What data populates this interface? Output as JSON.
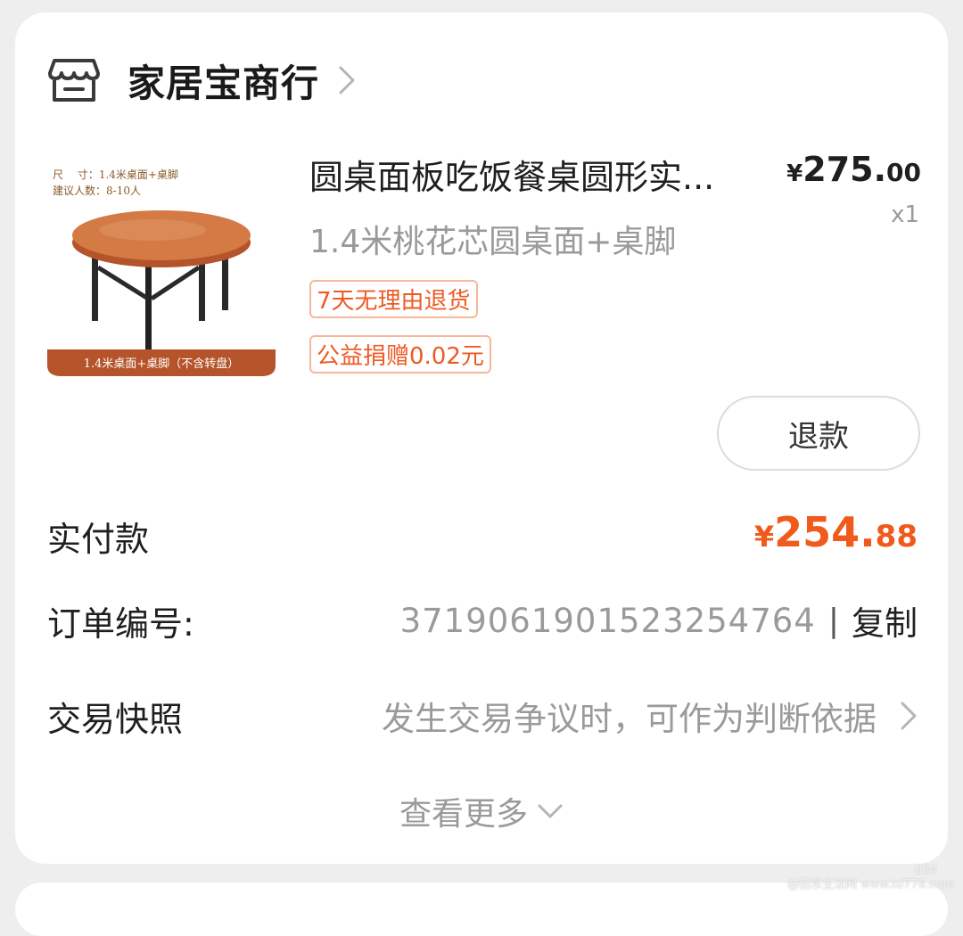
{
  "shop": {
    "name": "家居宝商行"
  },
  "product": {
    "title": "圆桌面板吃饭餐桌圆形实...",
    "spec": "1.4米桃花芯圆桌面+桌脚",
    "price_symbol": "¥",
    "price_int": "275.",
    "price_dec": "00",
    "qty": "x1",
    "tags": [
      "7天无理由退货",
      "公益捐赠0.02元"
    ],
    "image_text": {
      "size_line": "尺　 寸：1.4米桌面+桌脚",
      "people_line": "建议人数：8-10人",
      "banner": "1.4米桌面+桌脚（不含转盘）"
    },
    "refund_label": "退款"
  },
  "payment": {
    "label": "实付款",
    "symbol": "¥",
    "int": "254.",
    "dec": "88"
  },
  "order": {
    "label": "订单编号:",
    "number": "3719061901523254764",
    "separator": "|",
    "copy_label": "复制"
  },
  "snapshot": {
    "label": "交易快照",
    "desc": "发生交易争议时，可作为判断依据"
  },
  "more": {
    "label": "查看更多"
  },
  "watermark": {
    "text": "@田东生活网 www.td776.com",
    "year": "024"
  },
  "colors": {
    "accent": "#f05a1a",
    "tag_border": "#f7b79a",
    "muted": "#9a9a9a"
  }
}
